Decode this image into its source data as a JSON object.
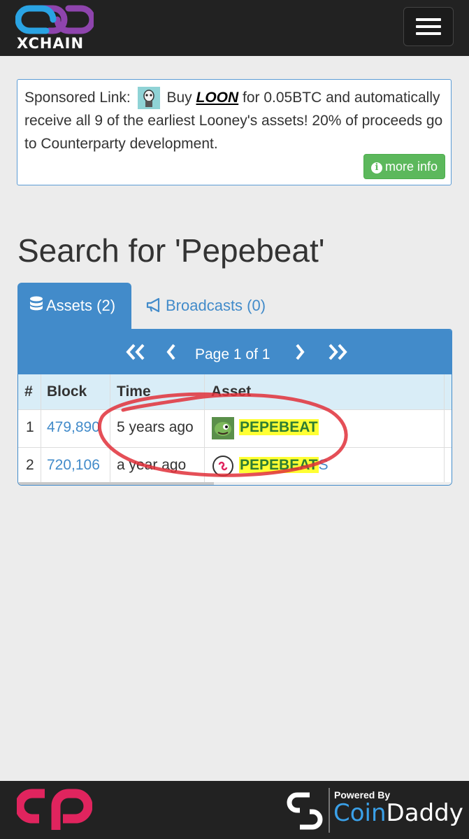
{
  "header": {
    "logo_text": "XCHAIN",
    "menu_button": "menu"
  },
  "sponsor": {
    "prefix": "Sponsored Link:",
    "buy": "Buy",
    "asset": "LOON",
    "line_rest": "for 0.05BTC and automatically receive all 9 of the earliest Looney's assets! 20% of proceeds go to Counterparty development.",
    "more_info": "more info"
  },
  "page_title": "Search for 'Pepebeat'",
  "tabs": [
    {
      "label": "Assets (2)",
      "icon": "database-icon",
      "active": true
    },
    {
      "label": "Broadcasts (0)",
      "icon": "bullhorn-icon",
      "active": false
    }
  ],
  "pager": {
    "text": "Page 1 of 1"
  },
  "table": {
    "headers": [
      "#",
      "Block",
      "Time",
      "Asset"
    ],
    "rows": [
      {
        "num": "1",
        "block": "479,890",
        "time": "5 years ago",
        "asset_hl": "PEPEBEAT",
        "asset_tail": ""
      },
      {
        "num": "2",
        "block": "720,106",
        "time": "a year ago",
        "asset_hl": "PEPEBEAT",
        "asset_tail": "S"
      }
    ]
  },
  "footer": {
    "powered_by": "Powered By",
    "brand_a": "Coin",
    "brand_b": "Daddy"
  },
  "colors": {
    "primary": "#428bca",
    "success": "#5cb85c",
    "highlight": "#ffff33",
    "annotation": "#e0303a"
  }
}
